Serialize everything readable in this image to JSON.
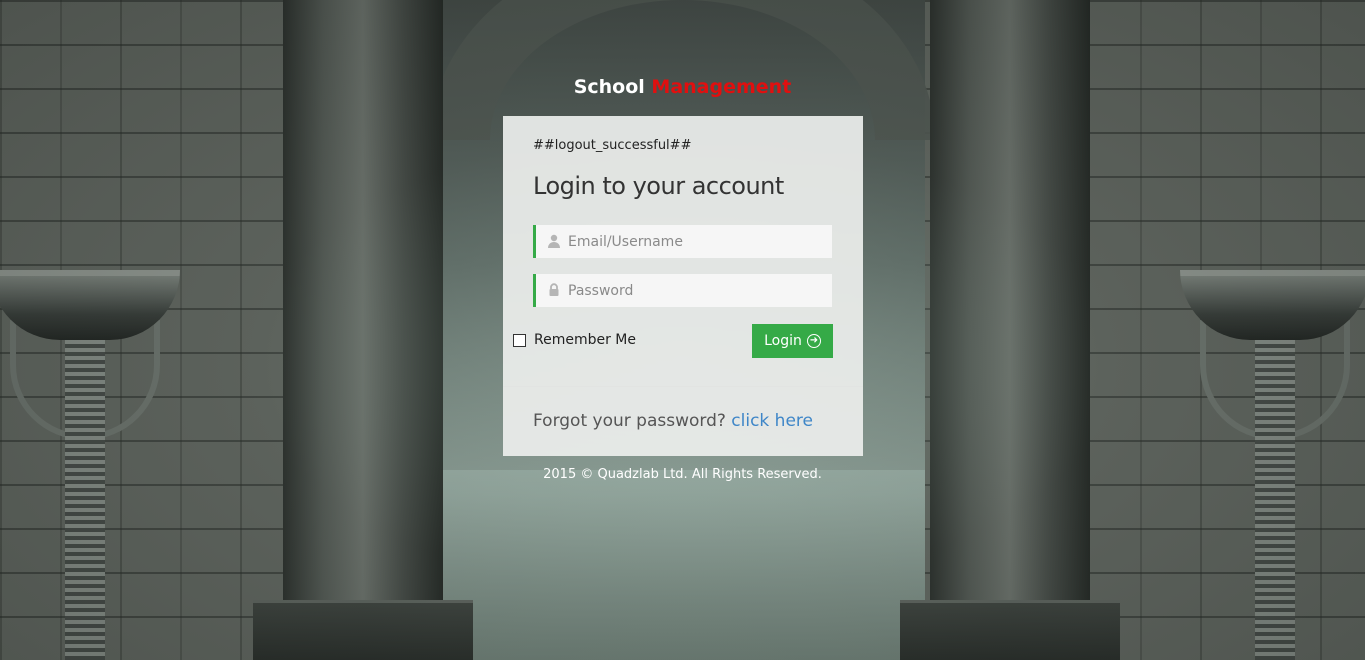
{
  "brand": {
    "part1": "School",
    "part2": "Management",
    "accent_color": "#e10f0f"
  },
  "login_panel": {
    "message": "##logout_successful##",
    "heading": "Login to your account",
    "username": {
      "placeholder": "Email/Username",
      "value": "",
      "icon": "user-icon"
    },
    "password": {
      "placeholder": "Password",
      "value": "",
      "icon": "lock-icon"
    },
    "remember_label": "Remember Me",
    "remember_checked": false,
    "login_button": "Login",
    "login_button_icon": "arrow-circle-right-icon",
    "forgot_text": "Forgot your password?",
    "forgot_link": "click here"
  },
  "footer": {
    "copyright": "2015 © Quadzlab Ltd. All Rights Reserved."
  },
  "colors": {
    "primary_green": "#35aa47",
    "link_blue": "#3e86c8"
  }
}
